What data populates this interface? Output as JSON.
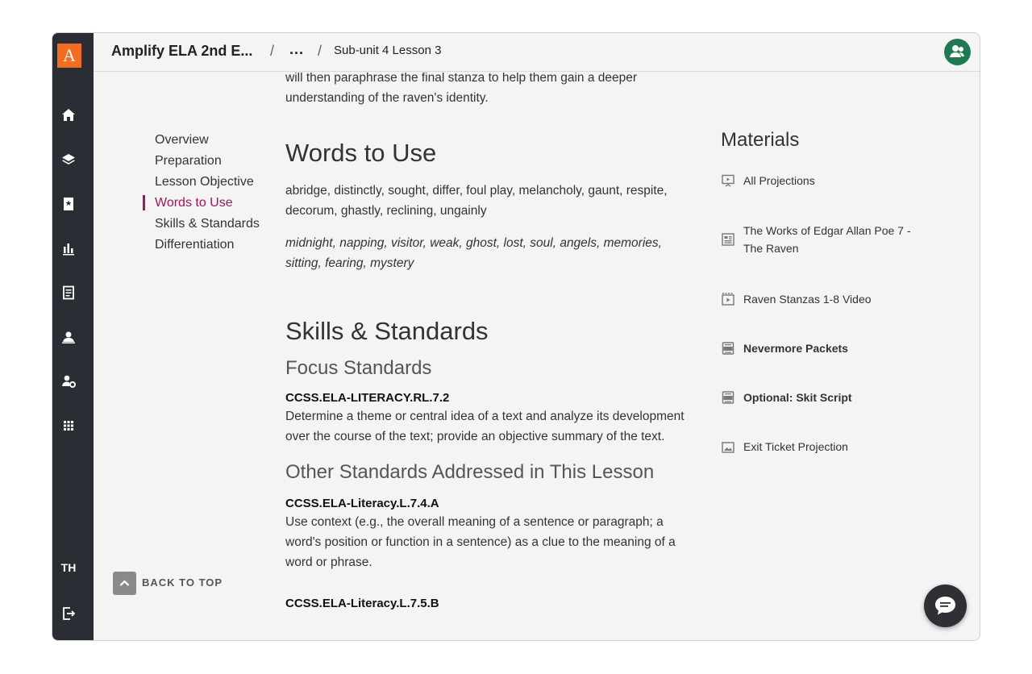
{
  "app": {
    "logo_letter": "A",
    "user_initials": "TH"
  },
  "breadcrumb": {
    "program": "Amplify ELA 2nd E...",
    "separator": "/",
    "ellipsis": "...",
    "lesson": "Sub-unit 4 Lesson 3"
  },
  "intro_text": {
    "line1": "will then paraphrase the final stanza to help them gain a deeper",
    "line2": "understanding of the raven's identity."
  },
  "toc": {
    "items": [
      "Overview",
      "Preparation",
      "Lesson Objective",
      "Words to Use",
      "Skills & Standards",
      "Differentiation"
    ],
    "active_index": 3
  },
  "words": {
    "heading": "Words to Use",
    "list": "abridge, distinctly, sought, differ, foul play, melancholy, gaunt, respite, decorum, ghastly, reclining, ungainly",
    "italic_list": "midnight, napping, visitor, weak, ghost, lost, soul, angels, memories, sitting, fearing, mystery"
  },
  "skills": {
    "heading": "Skills & Standards",
    "focus_heading": "Focus Standards",
    "focus": [
      {
        "code": "CCSS.ELA-LITERACY.RL.7.2",
        "text": "Determine a theme or central idea of a text and analyze its development over the course of the text; provide an objective summary of the text."
      }
    ],
    "other_heading": "Other Standards Addressed in This Lesson",
    "other": [
      {
        "code": "CCSS.ELA-Literacy.L.7.4.A",
        "text": "Use context (e.g., the overall meaning of a sentence or paragraph; a word's position or function in a sentence) as a clue to the meaning of a word or phrase."
      },
      {
        "code": "CCSS.ELA-Literacy.L.7.5.B",
        "text": ""
      }
    ]
  },
  "materials": {
    "heading": "Materials",
    "items": [
      {
        "label": "All Projections",
        "icon": "projection-icon",
        "bold": false
      },
      {
        "label": "The Works of Edgar Allan Poe 7 - The Raven",
        "icon": "document-icon",
        "bold": false
      },
      {
        "label": "Raven Stanzas 1-8 Video",
        "icon": "video-icon",
        "bold": false
      },
      {
        "label": "Nevermore Packets",
        "icon": "pdf-icon",
        "bold": true
      },
      {
        "label": "Optional: Skit Script",
        "icon": "pdf-icon",
        "bold": true
      },
      {
        "label": "Exit Ticket Projection",
        "icon": "image-icon",
        "bold": false
      }
    ]
  },
  "back_to_top": "BACK TO TOP",
  "colors": {
    "accent": "#a1145e",
    "logo": "#f26c22",
    "rail": "#2a2d33",
    "avatar": "#1e7a4f"
  }
}
